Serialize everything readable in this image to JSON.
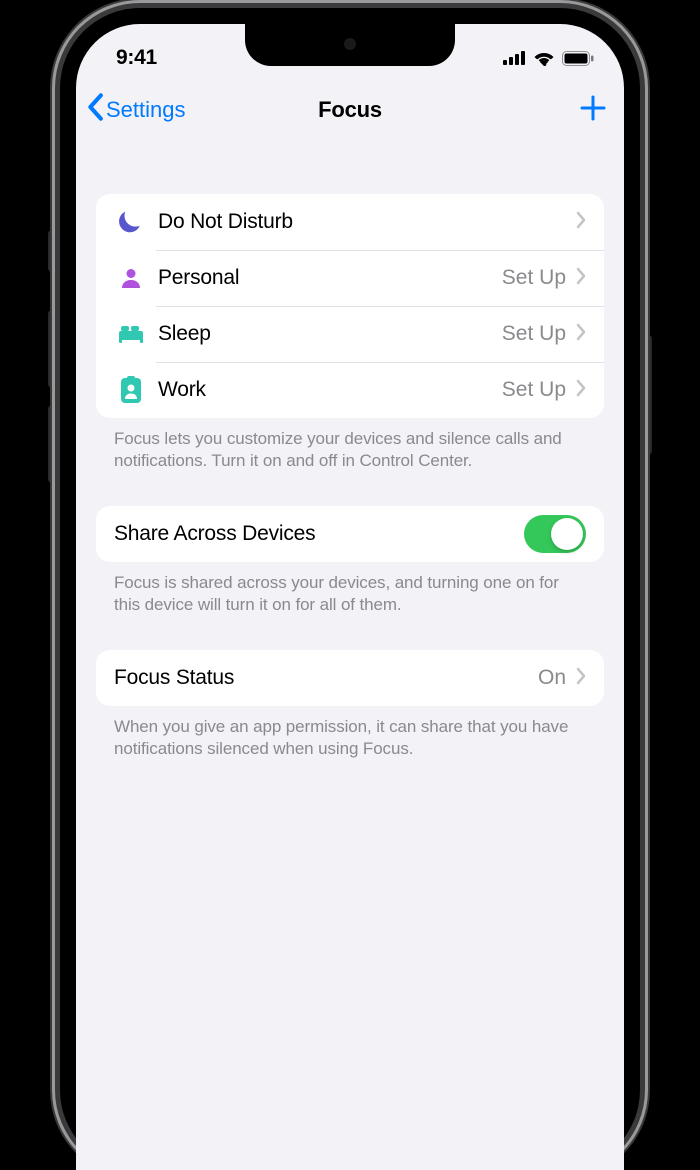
{
  "status": {
    "time": "9:41"
  },
  "nav": {
    "back_label": "Settings",
    "title": "Focus"
  },
  "focus_modes": [
    {
      "label": "Do Not Disturb",
      "detail": ""
    },
    {
      "label": "Personal",
      "detail": "Set Up"
    },
    {
      "label": "Sleep",
      "detail": "Set Up"
    },
    {
      "label": "Work",
      "detail": "Set Up"
    }
  ],
  "focus_footer": "Focus lets you customize your devices and silence calls and notifications. Turn it on and off in Control Center.",
  "share": {
    "label": "Share Across Devices",
    "on": true
  },
  "share_footer": "Focus is shared across your devices, and turning one on for this device will turn it on for all of them.",
  "status_row": {
    "label": "Focus Status",
    "value": "On"
  },
  "status_footer": "When you give an app permission, it can share that you have notifications silenced when using Focus.",
  "icon_colors": {
    "dnd": "#5856cf",
    "personal": "#af52de",
    "sleep": "#30c8b1",
    "work": "#30c8b1",
    "toggle_on": "#34c759"
  }
}
